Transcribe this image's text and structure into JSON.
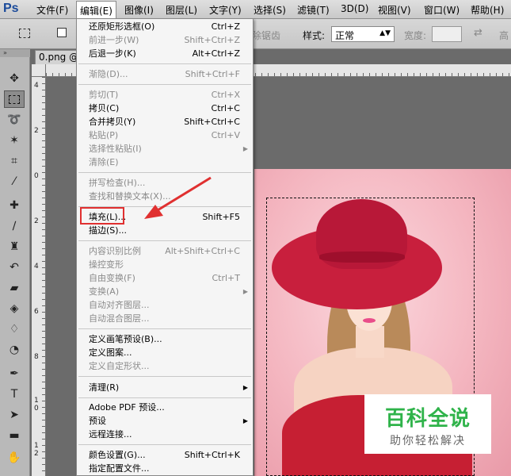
{
  "app": {
    "logo": "Ps"
  },
  "menubar": {
    "items": [
      "文件(F)",
      "编辑(E)",
      "图像(I)",
      "图层(L)",
      "文字(Y)",
      "选择(S)",
      "滤镜(T)",
      "3D(D)",
      "视图(V)",
      "窗口(W)",
      "帮助(H)"
    ]
  },
  "options": {
    "antialias_label": "除锯齿",
    "style_label": "样式:",
    "style_value": "正常",
    "width_label": "宽度:",
    "height_label": "高"
  },
  "document": {
    "tab_label": "0.png @"
  },
  "rulers": {
    "left_numbers": [
      "4",
      "2",
      "0",
      "2",
      "4",
      "6",
      "8",
      "1\n0",
      "1\n2"
    ]
  },
  "edit_menu": {
    "items": [
      {
        "label": "还原矩形选框(O)",
        "shortcut": "Ctrl+Z",
        "enabled": true
      },
      {
        "label": "前进一步(W)",
        "shortcut": "Shift+Ctrl+Z",
        "enabled": false
      },
      {
        "label": "后退一步(K)",
        "shortcut": "Alt+Ctrl+Z",
        "enabled": true
      },
      {
        "label": "渐隐(D)...",
        "shortcut": "Shift+Ctrl+F",
        "enabled": false
      },
      {
        "label": "剪切(T)",
        "shortcut": "Ctrl+X",
        "enabled": false
      },
      {
        "label": "拷贝(C)",
        "shortcut": "Ctrl+C",
        "enabled": true
      },
      {
        "label": "合并拷贝(Y)",
        "shortcut": "Shift+Ctrl+C",
        "enabled": true
      },
      {
        "label": "粘贴(P)",
        "shortcut": "Ctrl+V",
        "enabled": false
      },
      {
        "label": "选择性粘贴(I)",
        "shortcut": "",
        "enabled": false,
        "submenu": true
      },
      {
        "label": "清除(E)",
        "shortcut": "",
        "enabled": false
      },
      {
        "label": "拼写检查(H)...",
        "shortcut": "",
        "enabled": false
      },
      {
        "label": "查找和替换文本(X)...",
        "shortcut": "",
        "enabled": false
      },
      {
        "label": "填充(L)...",
        "shortcut": "Shift+F5",
        "enabled": true,
        "highlighted": true
      },
      {
        "label": "描边(S)...",
        "shortcut": "",
        "enabled": true
      },
      {
        "label": "内容识别比例",
        "shortcut": "Alt+Shift+Ctrl+C",
        "enabled": false
      },
      {
        "label": "操控变形",
        "shortcut": "",
        "enabled": false
      },
      {
        "label": "自由变换(F)",
        "shortcut": "Ctrl+T",
        "enabled": false
      },
      {
        "label": "变换(A)",
        "shortcut": "",
        "enabled": false,
        "submenu": true
      },
      {
        "label": "自动对齐图层...",
        "shortcut": "",
        "enabled": false
      },
      {
        "label": "自动混合图层...",
        "shortcut": "",
        "enabled": false
      },
      {
        "label": "定义画笔预设(B)...",
        "shortcut": "",
        "enabled": true
      },
      {
        "label": "定义图案...",
        "shortcut": "",
        "enabled": true
      },
      {
        "label": "定义自定形状...",
        "shortcut": "",
        "enabled": false
      },
      {
        "label": "清理(R)",
        "shortcut": "",
        "enabled": true,
        "submenu": true
      },
      {
        "label": "Adobe PDF 预设...",
        "shortcut": "",
        "enabled": true
      },
      {
        "label": "预设",
        "shortcut": "",
        "enabled": true,
        "submenu": true
      },
      {
        "label": "远程连接...",
        "shortcut": "",
        "enabled": true
      },
      {
        "label": "颜色设置(G)...",
        "shortcut": "Shift+Ctrl+K",
        "enabled": true
      },
      {
        "label": "指定配置文件...",
        "shortcut": "",
        "enabled": true
      }
    ]
  },
  "watermark": {
    "title": "百科全说",
    "subtitle": "助你轻松解决"
  },
  "colors": {
    "highlight": "#e03030",
    "watermark_green": "#2fb34a"
  }
}
